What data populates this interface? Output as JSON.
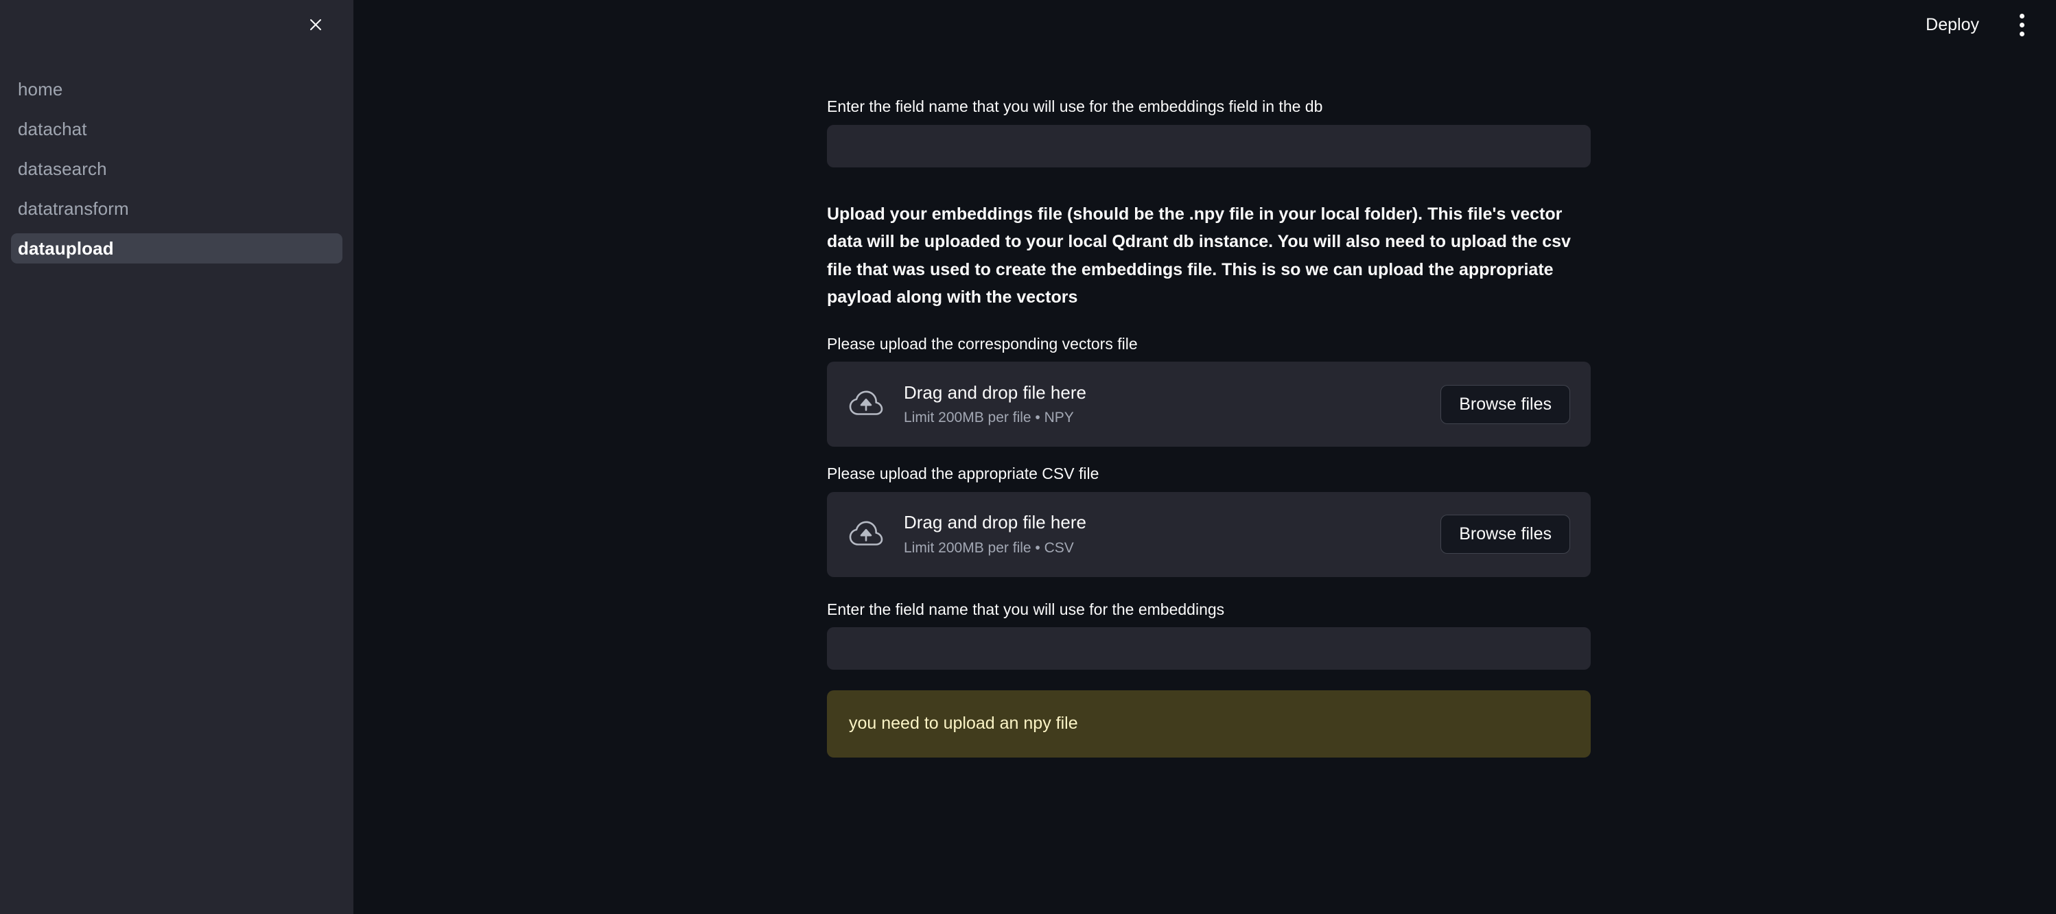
{
  "sidebar": {
    "close_icon": "close-icon",
    "items": [
      {
        "label": "home",
        "active": false
      },
      {
        "label": "datachat",
        "active": false
      },
      {
        "label": "datasearch",
        "active": false
      },
      {
        "label": "datatransform",
        "active": false
      },
      {
        "label": "dataupload",
        "active": true
      }
    ]
  },
  "header": {
    "deploy_label": "Deploy",
    "menu_icon": "kebab-menu-icon"
  },
  "main": {
    "db_field_label": "Enter the field name that you will use for the embeddings field in the db",
    "db_field_value": "",
    "db_field_placeholder": "",
    "description": "Upload your embeddings file (should be the .npy file in your local folder). This file's vector data will be uploaded to your local Qdrant db instance. You will also need to upload the csv file that was used to create the embeddings file. This is so we can upload the appropriate payload along with the vectors",
    "vectors_uploader": {
      "label": "Please upload the corresponding vectors file",
      "icon": "cloud-upload-icon",
      "drop_text": "Drag and drop file here",
      "limit_text": "Limit 200MB per file • NPY",
      "browse_label": "Browse files"
    },
    "csv_uploader": {
      "label": "Please upload the appropriate CSV file",
      "icon": "cloud-upload-icon",
      "drop_text": "Drag and drop file here",
      "limit_text": "Limit 200MB per file • CSV",
      "browse_label": "Browse files"
    },
    "embeddings_field_label": "Enter the field name that you will use for the embeddings",
    "embeddings_field_value": "",
    "embeddings_field_placeholder": "",
    "warning_text": "you need to upload an npy file"
  },
  "colors": {
    "app_background": "#0e1117",
    "sidebar_background": "#262730",
    "sidebar_active": "#3e414c",
    "widget_background": "#262730",
    "text_primary": "#fafafa",
    "text_muted": "#a3a8b4",
    "warning_background": "#413c1d",
    "warning_text": "#fbf4c6"
  }
}
